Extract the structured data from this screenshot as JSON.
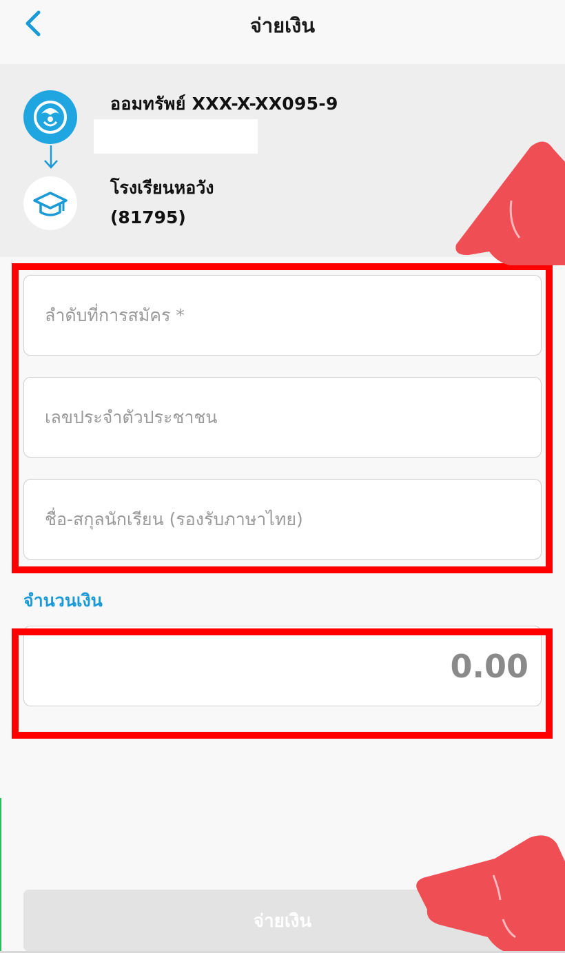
{
  "nav": {
    "title": "จ่ายเงิน"
  },
  "account": {
    "from_account": "ออมทรัพย์ XXX-X-XX095-9",
    "to_name": "โรงเรียนหอวัง",
    "to_code": "(81795)"
  },
  "form": {
    "field1_placeholder": "ลำดับที่การสมัคร *",
    "field2_placeholder": "เลขประจำตัวประชาชน",
    "field3_placeholder": "ชื่อ-สกุลนักเรียน (รองรับภาษาไทย)",
    "amount_label": "จำนวนเงิน",
    "amount_placeholder": "0.00"
  },
  "footer": {
    "pay_button": "จ่ายเงิน"
  },
  "colors": {
    "accent": "#1a9ad6",
    "highlight": "#ff0000",
    "pointer": "#f04e55"
  },
  "icons": {
    "back": "chevron-left-icon",
    "bank": "bank-logo-icon",
    "arrow": "arrow-down-icon",
    "school": "graduation-cap-icon"
  }
}
